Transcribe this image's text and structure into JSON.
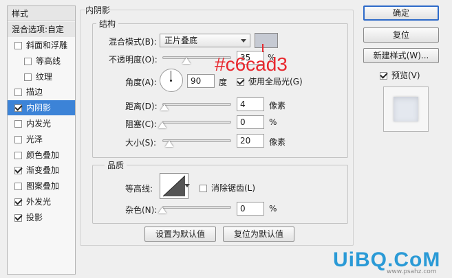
{
  "style_list": {
    "header": "样式",
    "blend_label": "混合选项:自定",
    "items": [
      {
        "label": "斜面和浮雕",
        "checked": false,
        "indent": false,
        "selected": false
      },
      {
        "label": "等高线",
        "checked": false,
        "indent": true,
        "selected": false
      },
      {
        "label": "纹理",
        "checked": false,
        "indent": true,
        "selected": false
      },
      {
        "label": "描边",
        "checked": false,
        "indent": false,
        "selected": false
      },
      {
        "label": "内阴影",
        "checked": true,
        "indent": false,
        "selected": true
      },
      {
        "label": "内发光",
        "checked": false,
        "indent": false,
        "selected": false
      },
      {
        "label": "光泽",
        "checked": false,
        "indent": false,
        "selected": false
      },
      {
        "label": "颜色叠加",
        "checked": false,
        "indent": false,
        "selected": false
      },
      {
        "label": "渐变叠加",
        "checked": true,
        "indent": false,
        "selected": false
      },
      {
        "label": "图案叠加",
        "checked": false,
        "indent": false,
        "selected": false
      },
      {
        "label": "外发光",
        "checked": true,
        "indent": false,
        "selected": false
      },
      {
        "label": "投影",
        "checked": true,
        "indent": false,
        "selected": false
      }
    ]
  },
  "panel": {
    "title": "内阴影",
    "structure": {
      "title": "结构",
      "blend_mode_label": "混合模式(B):",
      "blend_mode_value": "正片叠底",
      "blend_color": "#c6cad3",
      "opacity_label": "不透明度(O):",
      "opacity_value": "35",
      "opacity_unit": "%",
      "opacity_fraction": 0.35,
      "angle_label": "角度(A):",
      "angle_value": "90",
      "angle_unit": "度",
      "global_light_label": "使用全局光(G)",
      "global_light_checked": true,
      "distance_label": "距离(D):",
      "distance_value": "4",
      "distance_unit": "像素",
      "distance_fraction": 0.03,
      "choke_label": "阻塞(C):",
      "choke_value": "0",
      "choke_unit": "%",
      "choke_fraction": 0.0,
      "size_label": "大小(S):",
      "size_value": "20",
      "size_unit": "像素",
      "size_fraction": 0.1
    },
    "quality": {
      "title": "品质",
      "contour_label": "等高线:",
      "antialias_label": "消除锯齿(L)",
      "antialias_checked": false,
      "noise_label": "杂色(N):",
      "noise_value": "0",
      "noise_unit": "%",
      "noise_fraction": 0.0
    },
    "set_default_label": "设置为默认值",
    "reset_default_label": "复位为默认值"
  },
  "annotation": {
    "text": "#c6cad3",
    "color": "#e8282e"
  },
  "right": {
    "ok_label": "确定",
    "reset_label": "复位",
    "new_style_label": "新建样式(W)...",
    "preview_label": "预览(V)",
    "preview_checked": true
  },
  "watermark": {
    "brand": "UiBQ.CoM",
    "site": "www.psahz.com"
  }
}
